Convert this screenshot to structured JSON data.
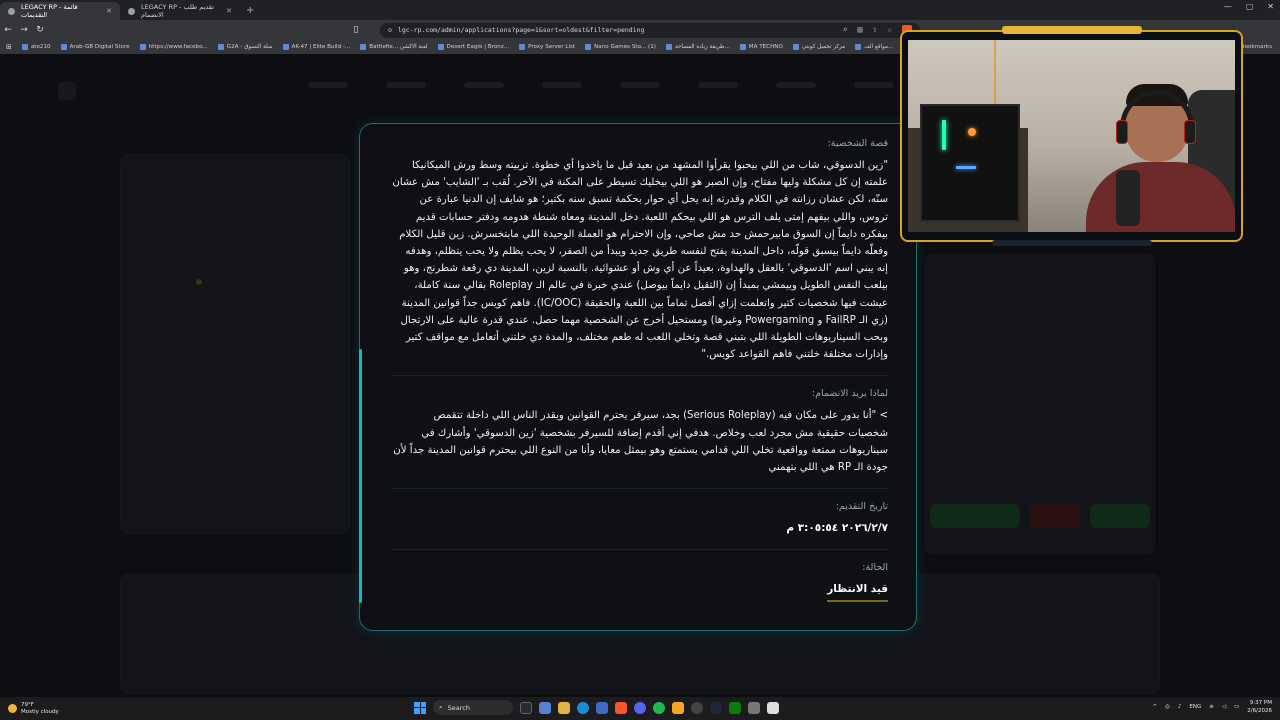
{
  "browser": {
    "tabs": [
      {
        "title": "LEGACY RP - قائمة التقديمات",
        "active": true
      },
      {
        "title": "LEGACY RP - تقديم طلب الانضمام",
        "active": false
      }
    ],
    "new_tab": "+",
    "url": "lgc-rp.com/admin/applications?page=1&sort=oldest&filter=pending",
    "bookmarks": [
      "ato210",
      "Arab-GB Digital Store",
      "https://www.facebo...",
      "G2A - سلة التسوق",
      "AK-47 | Elite Build -...",
      "Battlefie... لعبة الاكشن",
      "Desert Eagle | Bronz...",
      "Proxy Server List",
      "Nano Games Sto... (1)",
      "طريقة زيادة المساحة...",
      "MA TECHNO",
      "مركز تحميل كوبتي",
      "مواقع الف..."
    ],
    "all_bookmarks": "All Bookmarks"
  },
  "modal": {
    "story_label": "قصة الشخصية:",
    "story_text": "\"زين الدسوقي، شاب من اللي بيحبوا يقرأوا المشهد من بعيد قبل ما ياخدوا أي خطوة. تربيته وسط ورش الميكانيكا علمته إن كل مشكلة وليها مفتاح، وإن الصبر هو اللي بيخليك تسيطر على المكنة في الآخر. لُقب بـ 'الشايب' مش عشان سنّه، لكن عشان رزانته في الكلام وقدرته إنه يحل أي حوار بحكمة تسبق سنه بكتير؛ هو شايف إن الدنيا عبارة عن تروس، واللي بيفهم إمتى يلف الترس هو اللي بيحكم اللعبة. دخل المدينة ومعاه شنطة هدومه ودفتر حسابات قديم بيفكره دايماً إن السوق مابيرحمش حد مش صاحي، وإن الاحترام هو العملة الوحيدة اللي مابتخسرش. زين قليل الكلام وفعلّه دايماً بيسبق قولّه، داخل المدينة يفتح لنفسه طريق جديد ويبدأ من الصفر، لا يحب يظلم ولا يحب يتظلم، وهدفه إنه يبني اسم 'الدسوقي' بالعقل والهداوة، بعيداً عن أي وش أو عشوائية. بالنسبة لزين، المدينة دي رقعة شطرنج، وهو بيلعب النفس الطويل وبيمشي بمبدأ إن (التقيل دايماً بيوصل) عندي خبرة في عالم الـ Roleplay بقالي سنة كاملة، عيشت فيها شخصيات كتير واتعلمت إزاي أفصل تماماً بين اللعبة والحقيقة (IC/OOC). فاهم كويس جداً قوانين المدينة (زي الـ FailRP و Powergaming وغيرها) ومستحيل أخرج عن الشخصية مهما حصل. عندي قدرة عالية على الارتجال وبحب السيناريوهات الطويلة اللي بتبني قصة وتخلي اللعب له طعم مختلف، والمدة دي خلتني أتعامل مع مواقف كتير وإدارات مختلفة خلتني فاهم القواعد كويس.\"",
    "why_label": "لماذا يريد الانضمام:",
    "why_text": "> \"أنا بدور على مكان فيه (Serious Roleplay) بجد، سيرفر يحترم القوانين ويقدر الناس اللي داخلة تتقمص شخصيات حقيقية مش مجرد لعب وخلاص. هدفي إني أقدم إضافة للسيرفر بشخصية 'زين الدسوقي' وأشارك في سيناريوهات ممتعة وواقعية تخلي اللي قدامي يستمتع وهو بيمثل معايا، وأنا من النوع اللي بيحترم قوانين المدينة جداً لأن جودة الـ RP هي اللي بتهمني",
    "date_label": "تاريخ التقديم:",
    "date_value": "٢٠٢٦/٢/٧ ٣:٠٥:٥٤ م",
    "status_label": "الحالة:",
    "status_value": "قيد الانتظار"
  },
  "taskbar": {
    "weather_temp": "79°F",
    "weather_desc": "Mostly cloudy",
    "search": "Search",
    "lang": "ENG",
    "time": "9:37 PM",
    "date": "2/6/2026"
  },
  "colors": {
    "modal_border": "#1e6e70",
    "accent_teal": "#18b7c4",
    "webcam_frame": "#d9a21f"
  }
}
